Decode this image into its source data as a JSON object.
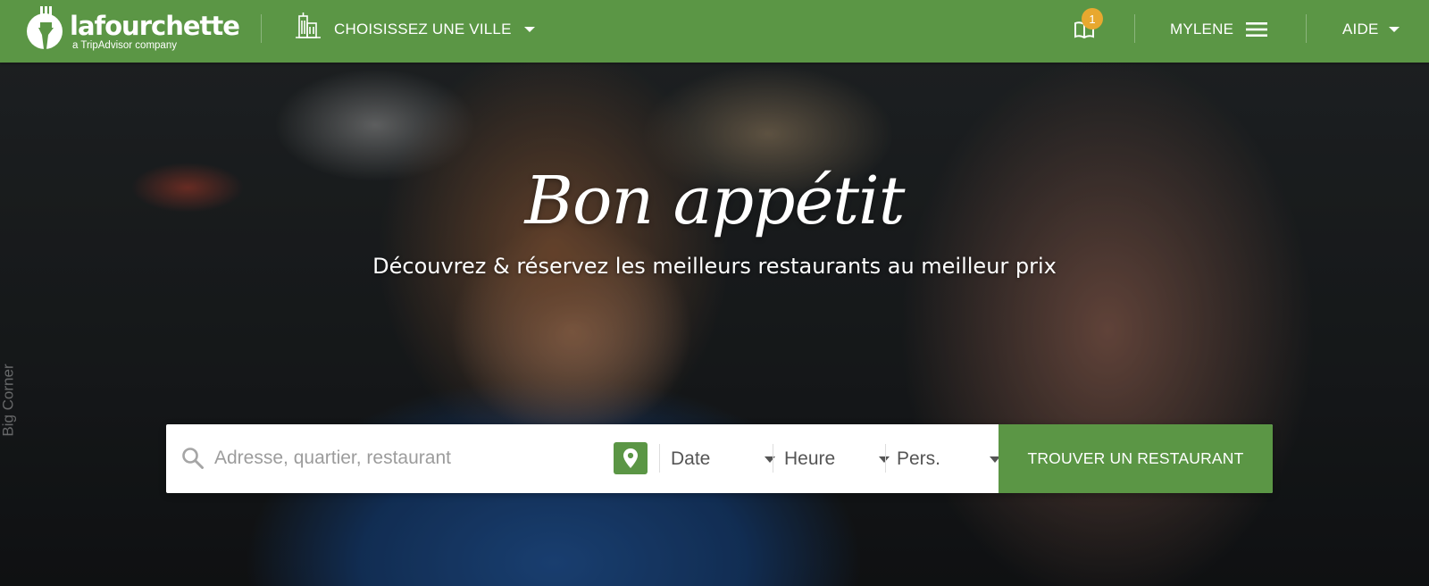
{
  "header": {
    "logo_wordmark": "lafourchette",
    "logo_tagline": "a TripAdvisor company",
    "city_selector": {
      "label": "CHOISISSEZ UNE VILLE",
      "icon": "city-buildings-icon"
    },
    "bookings": {
      "icon": "open-book-icon",
      "badge_count": "1"
    },
    "user": {
      "name": "MYLENE",
      "icon": "hamburger-menu-icon"
    },
    "help": {
      "label": "AIDE"
    }
  },
  "hero": {
    "title": "Bon appétit",
    "subtitle": "Découvrez & réservez les meilleurs restaurants au meilleur prix",
    "photo_credit": "Big Corner"
  },
  "search": {
    "query": {
      "placeholder": "Adresse, quartier, restaurant",
      "value": ""
    },
    "date": {
      "selected": "Date"
    },
    "time": {
      "selected": "Heure"
    },
    "party_size": {
      "selected": "Pers."
    },
    "submit_label": "TROUVER UN RESTAURANT"
  },
  "colors": {
    "brand_green": "#5b9645",
    "badge_orange": "#e8a82f",
    "text_white": "#ffffff"
  }
}
